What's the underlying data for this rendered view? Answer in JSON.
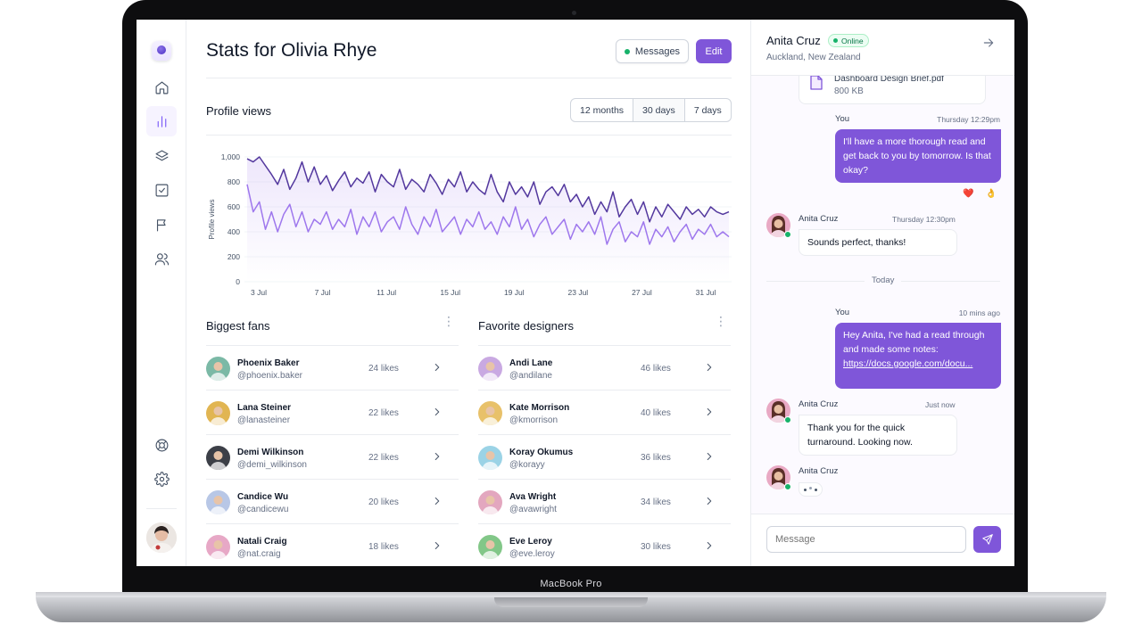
{
  "device_label": "MacBook Pro",
  "page": {
    "title": "Stats for Olivia Rhye",
    "messages_button": "Messages",
    "edit_button": "Edit"
  },
  "sidebar": {
    "items": [
      {
        "icon": "home-icon"
      },
      {
        "icon": "bar-chart-icon",
        "active": true
      },
      {
        "icon": "layers-icon"
      },
      {
        "icon": "check-square-icon"
      },
      {
        "icon": "flag-icon"
      },
      {
        "icon": "users-icon"
      }
    ],
    "bottom": [
      {
        "icon": "life-buoy-icon"
      },
      {
        "icon": "settings-icon"
      }
    ]
  },
  "profile_views": {
    "title": "Profile views",
    "ranges": [
      "12 months",
      "30 days",
      "7 days"
    ],
    "active_range": "30 days"
  },
  "chart_data": {
    "type": "line",
    "ylabel": "Profile views",
    "xlabel": "",
    "ylim": [
      0,
      1000
    ],
    "y_ticks": [
      "0",
      "200",
      "400",
      "600",
      "800",
      "1,000"
    ],
    "x_ticks": [
      "3 Jul",
      "7 Jul",
      "11 Jul",
      "15 Jul",
      "19 Jul",
      "23 Jul",
      "27 Jul",
      "31 Jul"
    ],
    "series": [
      {
        "color": "#53389e",
        "values": [
          985,
          960,
          1000,
          930,
          860,
          780,
          900,
          740,
          830,
          960,
          800,
          920,
          780,
          850,
          730,
          810,
          880,
          760,
          830,
          790,
          880,
          720,
          860,
          800,
          760,
          900,
          740,
          820,
          780,
          720,
          860,
          790,
          700,
          820,
          760,
          880,
          720,
          800,
          740,
          700,
          860,
          720,
          640,
          800,
          700,
          760,
          680,
          800,
          620,
          720,
          760,
          690,
          780,
          640,
          700,
          600,
          680,
          540,
          640,
          560,
          720,
          520,
          600,
          660,
          540,
          640,
          480,
          600,
          520,
          620,
          560,
          500,
          600,
          540,
          580,
          520,
          600,
          560,
          540,
          560
        ]
      },
      {
        "color": "#9e77ed",
        "values": [
          780,
          560,
          640,
          420,
          560,
          400,
          540,
          620,
          440,
          560,
          400,
          500,
          460,
          560,
          420,
          500,
          440,
          580,
          380,
          520,
          440,
          560,
          400,
          480,
          520,
          420,
          600,
          460,
          380,
          520,
          440,
          580,
          400,
          460,
          520,
          380,
          500,
          440,
          560,
          420,
          480,
          380,
          520,
          440,
          600,
          420,
          500,
          360,
          460,
          520,
          380,
          440,
          500,
          340,
          460,
          400,
          480,
          380,
          520,
          300,
          420,
          480,
          320,
          400,
          360,
          480,
          300,
          420,
          360,
          440,
          320,
          400,
          460,
          340,
          420,
          380,
          460,
          360,
          400,
          360
        ]
      }
    ]
  },
  "biggest_fans": {
    "title": "Biggest fans",
    "rows": [
      {
        "name": "Phoenix Baker",
        "handle": "@phoenix.baker",
        "likes": "24 likes",
        "color": "#7bb9a6"
      },
      {
        "name": "Lana Steiner",
        "handle": "@lanasteiner",
        "likes": "22 likes",
        "color": "#e1b552"
      },
      {
        "name": "Demi Wilkinson",
        "handle": "@demi_wilkinson",
        "likes": "22 likes",
        "color": "#3c3f47"
      },
      {
        "name": "Candice Wu",
        "handle": "@candicewu",
        "likes": "20 likes",
        "color": "#b8c7e6"
      },
      {
        "name": "Natali Craig",
        "handle": "@nat.craig",
        "likes": "18 likes",
        "color": "#e7a8c6"
      }
    ]
  },
  "favorite_designers": {
    "title": "Favorite designers",
    "rows": [
      {
        "name": "Andi Lane",
        "handle": "@andilane",
        "likes": "46 likes",
        "color": "#c9a9e2"
      },
      {
        "name": "Kate Morrison",
        "handle": "@kmorrison",
        "likes": "40 likes",
        "color": "#e8c16a"
      },
      {
        "name": "Koray Okumus",
        "handle": "@korayy",
        "likes": "36 likes",
        "color": "#9bd3e6"
      },
      {
        "name": "Ava Wright",
        "handle": "@avawright",
        "likes": "34 likes",
        "color": "#e3a7bf"
      },
      {
        "name": "Eve Leroy",
        "handle": "@eve.leroy",
        "likes": "30 likes",
        "color": "#82c788"
      }
    ]
  },
  "chat": {
    "name": "Anita Cruz",
    "status": "Online",
    "location": "Auckland, New Zealand",
    "file_name": "Dashboard Design Brief.pdf",
    "file_size": "800 KB",
    "msg1_sender": "You",
    "msg1_time": "Thursday 12:29pm",
    "msg1_text": "I'll have a more thorough read and get back to you by tomorrow. Is that okay?",
    "reactions": [
      "❤️",
      "👌"
    ],
    "msg2_sender": "Anita Cruz",
    "msg2_time": "Thursday 12:30pm",
    "msg2_text": "Sounds perfect, thanks!",
    "divider": "Today",
    "msg3_sender": "You",
    "msg3_time": "10 mins ago",
    "msg3_text": "Hey Anita, I've had a read through and made some notes:",
    "msg3_link": "https://docs.google.com/docu...",
    "msg4_sender": "Anita Cruz",
    "msg4_time": "Just now",
    "msg4_text": "Thank you for the quick turnaround. Looking now.",
    "msg5_sender": "Anita Cruz",
    "input_placeholder": "Message"
  }
}
